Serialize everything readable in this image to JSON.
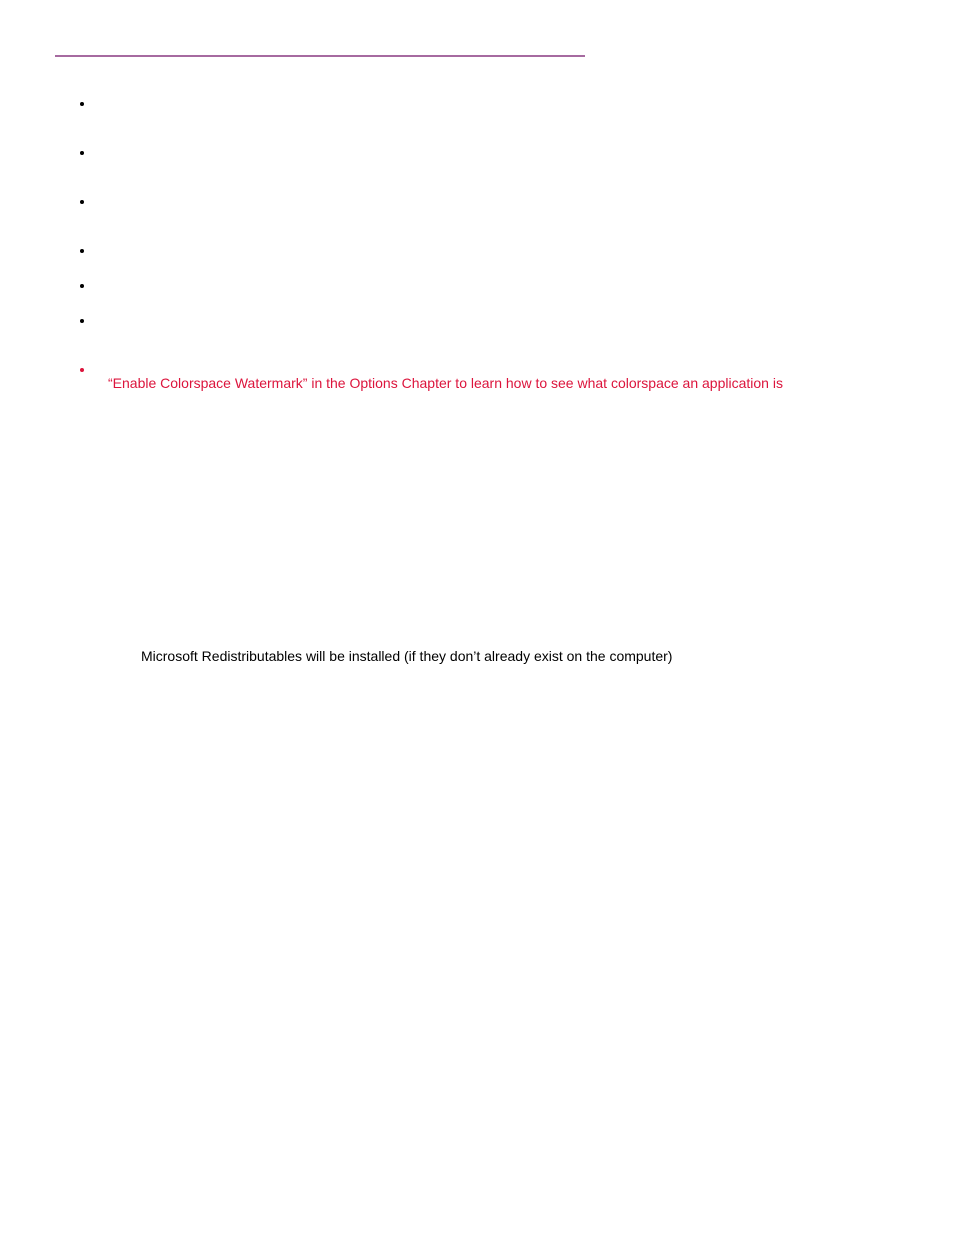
{
  "redContinuation": "“Enable Colorspace Watermark” in the Options Chapter to learn how to see what colorspace an application is",
  "standaloneParagraph": "Microsoft Redistributables will be installed (if they don’t already exist on the computer)"
}
